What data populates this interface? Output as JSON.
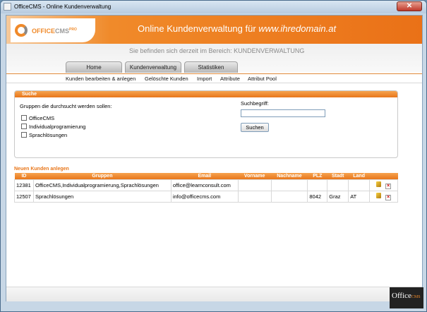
{
  "window": {
    "title": "OfficeCMS - Online Kundenverwaltung",
    "close_label": "✕"
  },
  "header": {
    "logo_text_main": "OFFICE",
    "logo_text_accent": "CMS",
    "logo_superscript": "PRO",
    "headline_prefix": "Online Kundenverwaltung für ",
    "headline_domain": "www.ihredomain.at",
    "location": "Sie befinden sich derzeit im Bereich: KUNDENVERWALTUNG"
  },
  "tabs": [
    {
      "label": "Home"
    },
    {
      "label": "Kundenverwaltung"
    },
    {
      "label": "Statistiken"
    }
  ],
  "subnav": [
    {
      "label": "Kunden bearbeiten & anlegen"
    },
    {
      "label": "Gelöschte Kunden"
    },
    {
      "label": "Import"
    },
    {
      "label": "Attribute"
    },
    {
      "label": "Attribut Pool"
    }
  ],
  "search": {
    "title": "Suche",
    "groups_label": "Gruppen die durchsucht werden sollen:",
    "groups": [
      {
        "label": "OfficeCMS",
        "checked": false
      },
      {
        "label": "Individualprogramierung",
        "checked": false
      },
      {
        "label": "Sprachlösungen",
        "checked": false
      }
    ],
    "term_label": "Suchbegriff:",
    "term_value": "",
    "button_label": "Suchen"
  },
  "new_customer_label": "Neuen Kunden anlegen",
  "table": {
    "columns": [
      "ID",
      "Gruppen",
      "Email",
      "Vorname",
      "Nachname",
      "PLZ",
      "Stadt",
      "Land",
      ""
    ],
    "rows": [
      {
        "id": "12381",
        "groups": "OfficeCMS,Individualprogramierung,Sprachlösungen",
        "email": "office@learnconsult.com",
        "first": "",
        "last": "",
        "plz": "",
        "city": "",
        "country": ""
      },
      {
        "id": "12507",
        "groups": "Sprachlösungen",
        "email": "info@officecms.com",
        "first": "",
        "last": "",
        "plz": "8042",
        "city": "Graz",
        "country": "AT"
      }
    ]
  },
  "badge": {
    "text": "Office",
    "suffix": "CMS"
  },
  "icons": {
    "edit": "pencil-icon",
    "delete": "delete-icon",
    "logo": "officecms-logo-icon"
  },
  "colors": {
    "accent": "#e8761a",
    "header_orange": "#ea7117"
  }
}
